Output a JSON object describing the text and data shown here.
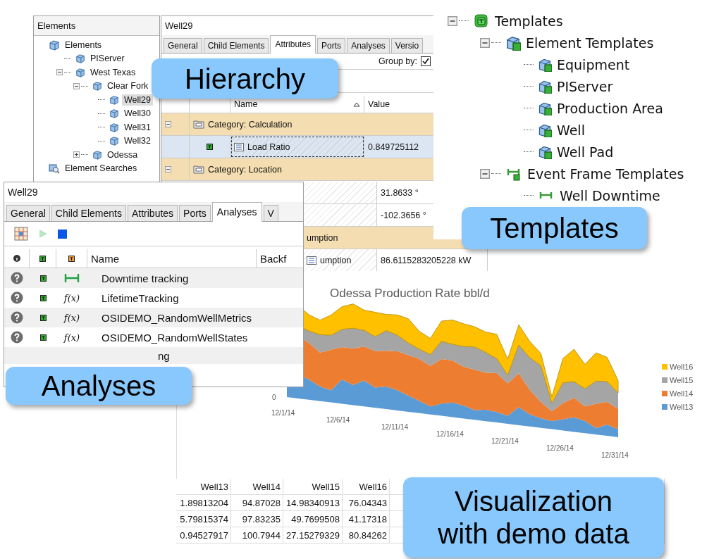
{
  "hierarchy_window": {
    "tree_title": "Elements",
    "tree": [
      {
        "label": "Elements",
        "kind": "root",
        "selected": false,
        "children": [
          {
            "label": "PIServer",
            "kind": "element",
            "selected": false
          },
          {
            "label": "West Texas",
            "kind": "element",
            "selected": false,
            "expanded": true,
            "children": [
              {
                "label": "Clear Fork",
                "kind": "element",
                "selected": false,
                "expanded": true,
                "children": [
                  {
                    "label": "Well29",
                    "kind": "element",
                    "selected": true
                  },
                  {
                    "label": "Well30",
                    "kind": "element",
                    "selected": false
                  },
                  {
                    "label": "Well31",
                    "kind": "element",
                    "selected": false
                  },
                  {
                    "label": "Well32",
                    "kind": "element",
                    "selected": false
                  }
                ]
              },
              {
                "label": "Odessa",
                "kind": "element",
                "selected": false,
                "expanded": false
              }
            ]
          }
        ]
      },
      {
        "label": "Element Searches",
        "kind": "search",
        "selected": false
      }
    ],
    "title": "Well29",
    "tabs": [
      {
        "label": "General",
        "selected": false
      },
      {
        "label": "Child Elements",
        "selected": false
      },
      {
        "label": "Attributes",
        "selected": true
      },
      {
        "label": "Ports",
        "selected": false
      },
      {
        "label": "Analyses",
        "selected": false
      },
      {
        "label": "Versio",
        "selected": false
      }
    ],
    "group_by": {
      "label": "Group by:",
      "checked": true
    },
    "columns": [
      "Name",
      "Value"
    ],
    "rows": [
      {
        "kind": "category",
        "label": "Category: Calculation",
        "expanded": true
      },
      {
        "kind": "attribute",
        "name": "Load Ratio",
        "value": "0.849725112",
        "selected": true
      },
      {
        "kind": "category",
        "label": "Category: Location",
        "expanded": true
      }
    ],
    "more_rows": [
      {
        "kind": "attribute",
        "value": "31.8633 °",
        "selected": false
      },
      {
        "kind": "attribute",
        "value": "-102.3656 °",
        "selected": false
      },
      {
        "kind": "category",
        "label": "umption"
      },
      {
        "kind": "attribute",
        "name": "umption",
        "value": "86.6115283205228 kW",
        "selected": false
      }
    ]
  },
  "templates_panel": {
    "tree": [
      {
        "label": "Templates",
        "kind": "root",
        "expanded": true,
        "children": [
          {
            "label": "Element Templates",
            "kind": "element-group",
            "expanded": true,
            "children": [
              {
                "label": "Equipment",
                "kind": "element"
              },
              {
                "label": "PIServer",
                "kind": "element"
              },
              {
                "label": "Production Area",
                "kind": "element"
              },
              {
                "label": "Well",
                "kind": "element"
              },
              {
                "label": "Well Pad",
                "kind": "element"
              }
            ]
          },
          {
            "label": "Event Frame Templates",
            "kind": "event-group",
            "expanded": true,
            "children": [
              {
                "label": "Well Downtime",
                "kind": "event"
              }
            ]
          }
        ]
      }
    ]
  },
  "analyses_window": {
    "title": "Well29",
    "tabs": [
      {
        "label": "General",
        "selected": false
      },
      {
        "label": "Child Elements",
        "selected": false
      },
      {
        "label": "Attributes",
        "selected": false
      },
      {
        "label": "Ports",
        "selected": false
      },
      {
        "label": "Analyses",
        "selected": true
      },
      {
        "label": "V",
        "selected": false
      }
    ],
    "columns": [
      "Name",
      "Backf"
    ],
    "rows": [
      {
        "kind": "event",
        "name": "Downtime tracking"
      },
      {
        "kind": "expression",
        "icon": "f(x)",
        "name": "LifetimeTracking"
      },
      {
        "kind": "expression",
        "icon": "f(x)",
        "name": "OSIDEMO_RandomWellMetrics"
      },
      {
        "kind": "expression",
        "icon": "f(x)",
        "name": "OSIDEMO_RandomWellStates"
      },
      {
        "kind": "partial",
        "name": "ng"
      }
    ]
  },
  "chart": {
    "title": "Odessa Production Rate bbl/d",
    "y_label": "0",
    "x_labels": [
      "12/1/14",
      "12/6/14",
      "12/11/14",
      "12/16/14",
      "12/21/14",
      "12/26/14",
      "12/31/14"
    ],
    "legend": [
      {
        "name": "Well16",
        "color": "#ffc000"
      },
      {
        "name": "Well15",
        "color": "#a5a5a5"
      },
      {
        "name": "Well14",
        "color": "#ed7d31"
      },
      {
        "name": "Well13",
        "color": "#5b9bd5"
      }
    ]
  },
  "data_table": {
    "columns": [
      "Well13",
      "Well14",
      "Well15",
      "Well16"
    ],
    "rows": [
      [
        "1.89813204",
        "94.87028",
        "14.98340913",
        "76.04343"
      ],
      [
        "5.79815374",
        "97.83235",
        "49.7699508",
        "41.17318"
      ],
      [
        "0.94527917",
        "100.7944",
        "27.15279329",
        "80.84262"
      ]
    ]
  },
  "callouts": [
    "Hierarchy",
    "Templates",
    "Analyses",
    "Visualization with demo data"
  ]
}
